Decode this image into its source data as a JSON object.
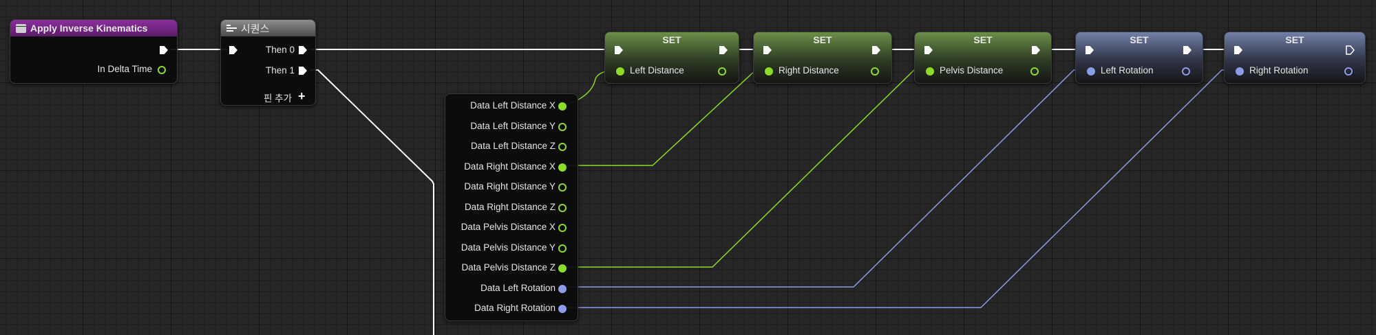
{
  "event_node": {
    "title": "Apply Inverse Kinematics",
    "pin_delta": "In Delta Time"
  },
  "sequence_node": {
    "title": "시퀀스",
    "then0": "Then 0",
    "then1": "Then 1",
    "add_pin": "핀 추가"
  },
  "data_node": {
    "outputs": [
      "Data Left Distance X",
      "Data Left Distance Y",
      "Data Left Distance Z",
      "Data Right Distance X",
      "Data Right Distance Y",
      "Data Right Distance Z",
      "Data Pelvis Distance X",
      "Data Pelvis Distance Y",
      "Data Pelvis Distance Z",
      "Data Left Rotation",
      "Data Right Rotation"
    ]
  },
  "set_nodes": [
    {
      "title": "SET",
      "var": "Left Distance",
      "kind": "float"
    },
    {
      "title": "SET",
      "var": "Right Distance",
      "kind": "float"
    },
    {
      "title": "SET",
      "var": "Pelvis Distance",
      "kind": "float"
    },
    {
      "title": "SET",
      "var": "Left Rotation",
      "kind": "rotator"
    },
    {
      "title": "SET",
      "var": "Right Rotation",
      "kind": "rotator"
    }
  ],
  "colors": {
    "float_pin": "#8cdc28",
    "rotator_pin": "#8c9ce6",
    "exec_wire": "#ffffff",
    "event_header": "#7a2a8a",
    "sequence_header": "#6a6a6a"
  }
}
